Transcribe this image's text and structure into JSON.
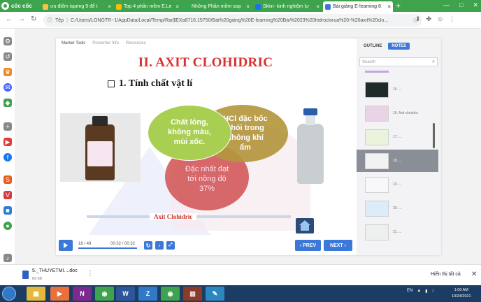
{
  "browser": {
    "brand": "cốc cốc",
    "tabs": [
      {
        "label": "ưu điểm ispring 9 để t",
        "close": "×",
        "icon_color": "#f4c542"
      },
      {
        "label": "Top 4 phần mềm E.Le",
        "close": "×",
        "icon_color": "#fbbc05"
      },
      {
        "label": "Những Phần mềm soạ",
        "close": "×",
        "icon_color": "#34a853"
      },
      {
        "label": "Skkn- kinh nghiệm lự",
        "close": "×",
        "icon_color": "#1a73e8"
      },
      {
        "label": "Bài giảng E-learning 8",
        "close": "×",
        "icon_color": "#3b78d8"
      }
    ],
    "new_tab": "+",
    "url_prefix": "Tệp",
    "url": "C:/Users/LONGTR~1/AppData/Local/Temp/Rar$EXa8716.15750/Bài%20giảng%20E-learning%20Bài%2023%20hidroclorua%20-%20axit%20clo...",
    "window_controls": [
      "—",
      "□",
      "✕"
    ]
  },
  "player": {
    "tabs": [
      "Marker Tools",
      "Presenter Info",
      "Resources"
    ],
    "slide": {
      "title": "II. AXIT CLOHIDRIC",
      "subtitle": "1. Tính chất vật lí",
      "circle_a": "Chất lỏng,\nkhông màu,\nmùi xốc.",
      "circle_b": "HCl đặc bốc\nkhói trong\nkhông khí\nẩm",
      "circle_c": "Đặc nhất đạt\ntới nồng độ\n37%",
      "caption": "Axit Clohidric"
    },
    "controls": {
      "slide_count": "18 / 49",
      "time": "00:32 / 00:32",
      "progress": 1.0,
      "prev_label": "‹ PREV",
      "next_label": "NEXT ›"
    }
  },
  "sidebar": {
    "tabs": [
      "OUTLINE",
      "NOTES"
    ],
    "search_placeholder": "Search",
    "thumbs": [
      {
        "label": "15. ..."
      },
      {
        "label": "16. Axit clohidric"
      },
      {
        "label": "17. ..."
      },
      {
        "label": "18. ..."
      },
      {
        "label": "19. ..."
      },
      {
        "label": "20. ..."
      },
      {
        "label": "21. ..."
      }
    ]
  },
  "download": {
    "filename": "5._THUYETMI....doc",
    "size": "69 kB",
    "show_all": "Hiển thị tất cả"
  },
  "taskbar": {
    "lang": "EN",
    "time": "1:00 AM",
    "date": "10/24/2021"
  }
}
